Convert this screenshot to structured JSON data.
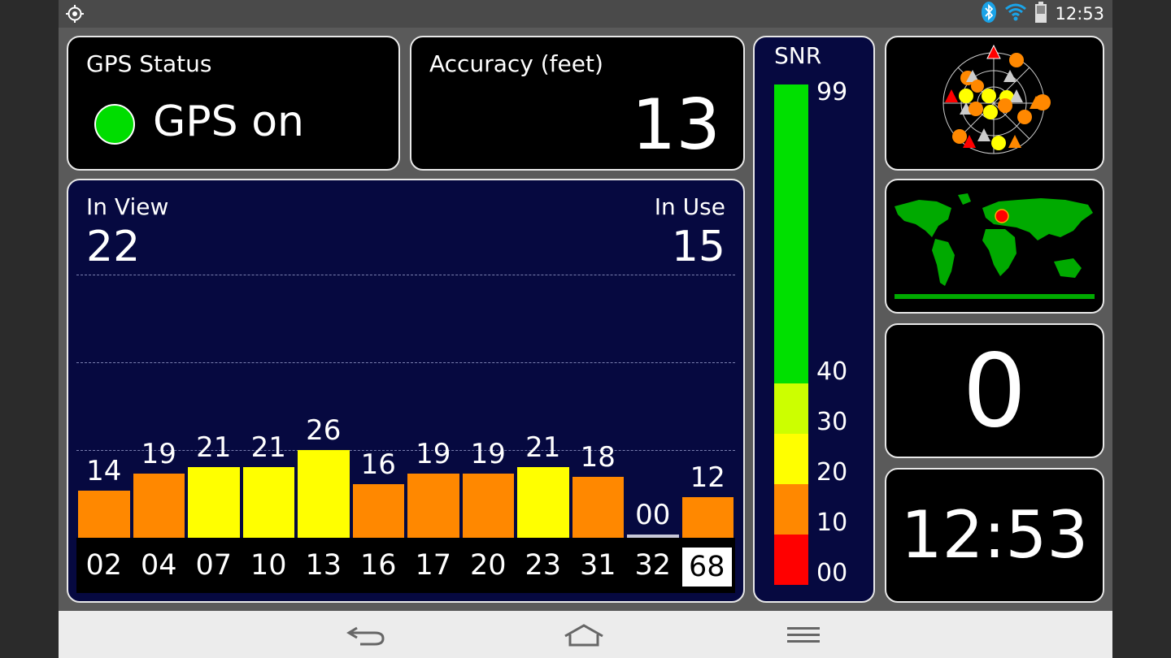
{
  "status_bar": {
    "time": "12:53",
    "icons": [
      "gps-target-icon",
      "bluetooth-icon",
      "wifi-icon",
      "battery-icon"
    ]
  },
  "gps_status": {
    "title": "GPS Status",
    "state": "GPS on",
    "indicator_color": "#00dd00"
  },
  "accuracy": {
    "title": "Accuracy (feet)",
    "value": "13"
  },
  "snr_legend": {
    "title": "SNR",
    "labels": [
      "99",
      "40",
      "30",
      "20",
      "10",
      "00"
    ],
    "bands": [
      {
        "from": 40,
        "to": 99,
        "color": "#00e000"
      },
      {
        "from": 30,
        "to": 40,
        "color": "#ccff00"
      },
      {
        "from": 20,
        "to": 30,
        "color": "#ffff00"
      },
      {
        "from": 10,
        "to": 20,
        "color": "#ff8800"
      },
      {
        "from": 0,
        "to": 10,
        "color": "#ff0000"
      }
    ]
  },
  "satellites": {
    "in_view_label": "In View",
    "in_view": "22",
    "in_use_label": "In Use",
    "in_use": "15"
  },
  "chart_data": {
    "type": "bar",
    "categories": [
      "02",
      "04",
      "07",
      "10",
      "13",
      "16",
      "17",
      "20",
      "23",
      "31",
      "32",
      "68"
    ],
    "values": [
      14,
      19,
      21,
      21,
      26,
      16,
      19,
      19,
      21,
      18,
      0,
      12
    ],
    "value_labels": [
      "14",
      "19",
      "21",
      "21",
      "26",
      "16",
      "19",
      "19",
      "21",
      "18",
      "00",
      "12"
    ],
    "highlighted": "68",
    "ylim": [
      0,
      99
    ],
    "grid": true
  },
  "speed": {
    "value": "0"
  },
  "clock": {
    "value": "12:53"
  },
  "nav": {
    "icons": [
      "back-icon",
      "home-icon",
      "menu-icon"
    ]
  }
}
